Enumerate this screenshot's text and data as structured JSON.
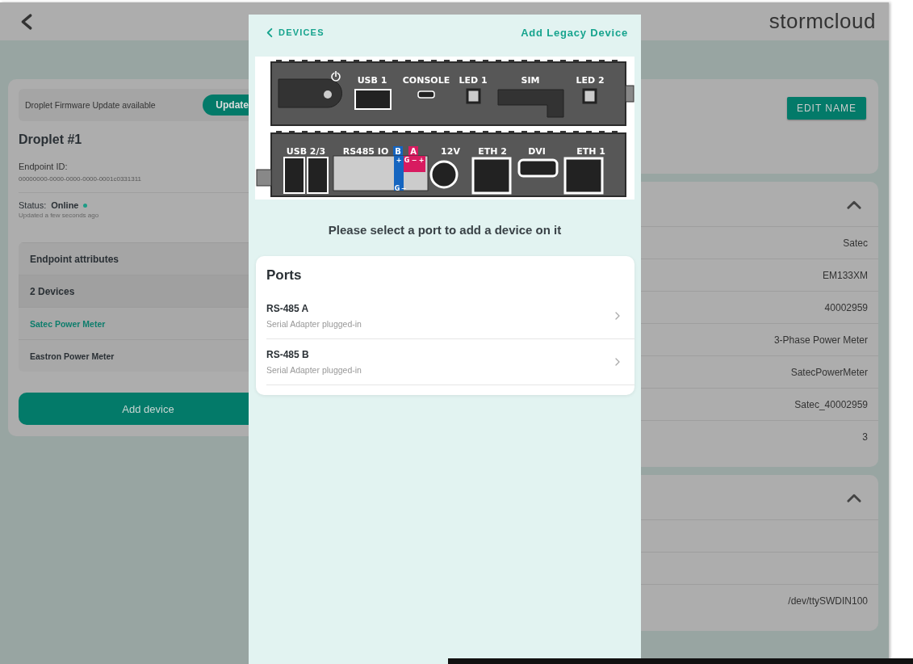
{
  "header": {
    "logo": "stormcloud"
  },
  "summary_card": {
    "banner": {
      "text": "Droplet Firmware Update available",
      "button": "Update"
    },
    "title": "Droplet #1",
    "endpoint_id": {
      "label": "Endpoint ID:",
      "value": "00000000-0000-0000-0000-0001c0331311"
    },
    "status": {
      "label": "Status:",
      "value": "Online",
      "online": true,
      "updated": "Updated a few seconds ago"
    },
    "rows": [
      {
        "kind": "header",
        "label": "Endpoint attributes",
        "selected": false
      },
      {
        "kind": "section",
        "label": "2 Devices",
        "selected": false
      },
      {
        "kind": "device",
        "label": "Satec Power Meter",
        "selected": true
      },
      {
        "kind": "device",
        "label": "Eastron Power Meter",
        "selected": false
      }
    ],
    "add_button": "Add device"
  },
  "name_card": {
    "button": "EDIT NAME"
  },
  "detail_cards": [
    {
      "expanded": true,
      "rows": [
        {
          "kind": "value",
          "value": "Satec"
        },
        {
          "kind": "value",
          "value": "EM133XM"
        },
        {
          "kind": "value",
          "value": "40002959"
        },
        {
          "kind": "value",
          "value": "3-Phase Power Meter"
        },
        {
          "kind": "value",
          "value": "SatecPowerMeter"
        },
        {
          "kind": "value",
          "value": "Satec_40002959"
        },
        {
          "kind": "value",
          "value": "3"
        }
      ]
    },
    {
      "expanded": true,
      "rows": [
        {
          "kind": "blank"
        },
        {
          "kind": "blank"
        },
        {
          "kind": "value",
          "value": "/dev/ttySWDIN100"
        }
      ]
    }
  ],
  "modal": {
    "back_link": "DEVICES",
    "action": "Add Legacy Device",
    "device": {
      "top_labels": [
        "USB 1",
        "CONSOLE",
        "LED 1",
        "SIM",
        "LED 2"
      ],
      "bottom_labels": [
        "USB 2/3",
        "RS485 IO",
        "12V",
        "ETH 2",
        "DVI",
        "ETH 1"
      ],
      "bus_b": "B",
      "bus_a": "A",
      "pins_b_top": "+",
      "pins_a_top": [
        "G",
        "−",
        "+"
      ],
      "pins_b_bottom": [
        "G",
        "−"
      ]
    },
    "prompt": "Please select a port to add a device on it",
    "ports": {
      "title": "Ports",
      "items": [
        {
          "name": "RS-485 A",
          "status": "Serial Adapter plugged-in"
        },
        {
          "name": "RS-485 B",
          "status": "Serial Adapter plugged-in"
        }
      ]
    }
  }
}
